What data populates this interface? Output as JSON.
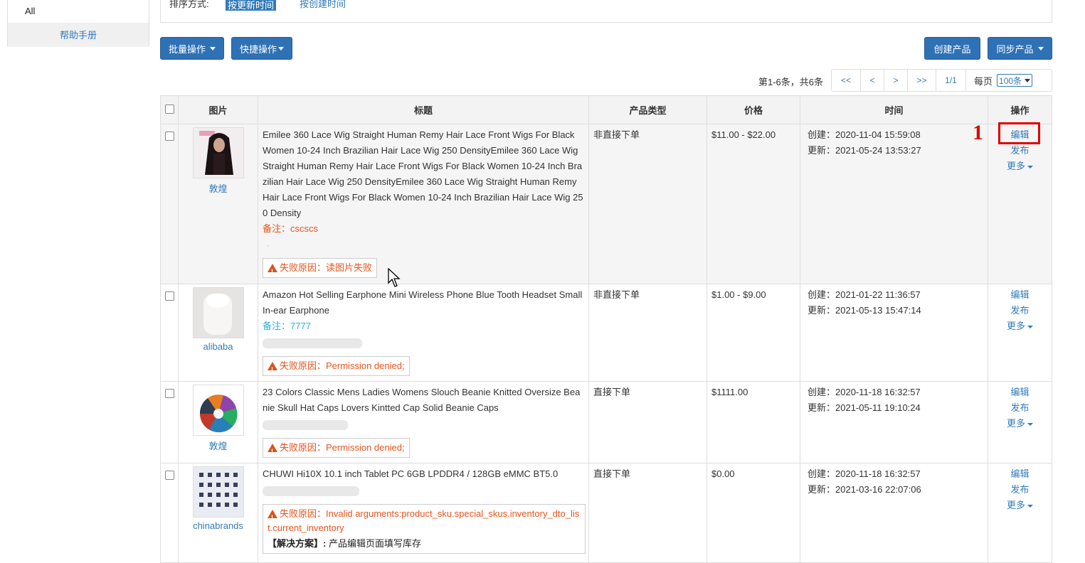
{
  "sidebar": {
    "all_label": "All",
    "help_label": "帮助手册"
  },
  "sort": {
    "label": "排序方式:",
    "active": "按更新时间",
    "other": "按创建时间"
  },
  "toolbar": {
    "bulk_label": "批量操作",
    "quick_label": "快捷操作",
    "create_label": "创建产品",
    "sync_label": "同步产品"
  },
  "pagination": {
    "info": "第1-6条，共6条",
    "first": "<<",
    "prev": "<",
    "next": ">",
    "last": ">>",
    "page": "1/1",
    "per_page_label": "每页",
    "per_page_value": "100条"
  },
  "table": {
    "headers": {
      "image": "图片",
      "title": "标题",
      "type": "产品类型",
      "price": "价格",
      "time": "时间",
      "ops": "操作"
    },
    "op_labels": {
      "edit": "编辑",
      "publish": "发布",
      "more": "更多"
    },
    "rows": [
      {
        "source": "敦煌",
        "title": "Emilee 360 Lace Wig Straight Human Remy Hair Lace Front Wigs For Black Women 10-24 Inch Brazilian Hair Lace Wig 250 DensityEmilee 360 Lace Wig Straight Human Remy Hair Lace Front Wigs For Black Women 10-24 Inch Brazilian Hair Lace Wig 250 DensityEmilee 360 Lace Wig Straight Human Remy Hair Lace Front Wigs For Black Women 10-24 Inch Brazilian Hair Lace Wig 250 Density",
        "note": "备注：cscscs",
        "fail": "失败原因：读图片失败",
        "type": "非直接下单",
        "price": "$11.00 - $22.00",
        "created": "创建：2020-11-04 15:59:08",
        "updated": "更新：2021-05-24 13:53:27"
      },
      {
        "source": "alibaba",
        "title": "Amazon Hot Selling Earphone Mini Wireless Phone Blue Tooth Headset Small In-ear Earphone",
        "note": "备注：7777",
        "fail": "失败原因：Permission denied;",
        "type": "非直接下单",
        "price": "$1.00 - $9.00",
        "created": "创建：2021-01-22 11:36:57",
        "updated": "更新：2021-05-13 15:47:14"
      },
      {
        "source": "敦煌",
        "title": "23 Colors Classic Mens Ladies Womens Slouch Beanie Knitted Oversize Beanie Skull Hat Caps Lovers Kintted Cap Solid Beanie Caps",
        "fail": "失败原因：Permission denied;",
        "type": "直接下单",
        "price": "$1111.00",
        "created": "创建：2020-11-18 16:32:57",
        "updated": "更新：2021-05-11 19:10:24"
      },
      {
        "source": "chinabrands",
        "title": "CHUWI Hi10X 10.1 inch Tablet PC 6GB LPDDR4 / 128GB eMMC BT5.0",
        "fail": "失败原因：Invalid arguments:product_sku.special_skus.inventory_dto_list.current_inventory",
        "solution_label": "【解决方案】:",
        "solution_text": "产品编辑页面填写库存",
        "type": "直接下单",
        "price": "$0.00",
        "created": "创建：2020-11-18 16:32:57",
        "updated": "更新：2021-03-16 22:07:06"
      }
    ]
  },
  "annotation": {
    "marker": "1"
  },
  "colors": {
    "primary": "#2f71b5",
    "link": "#337ab7",
    "error": "#e8541c",
    "highlight": "#e00000"
  }
}
